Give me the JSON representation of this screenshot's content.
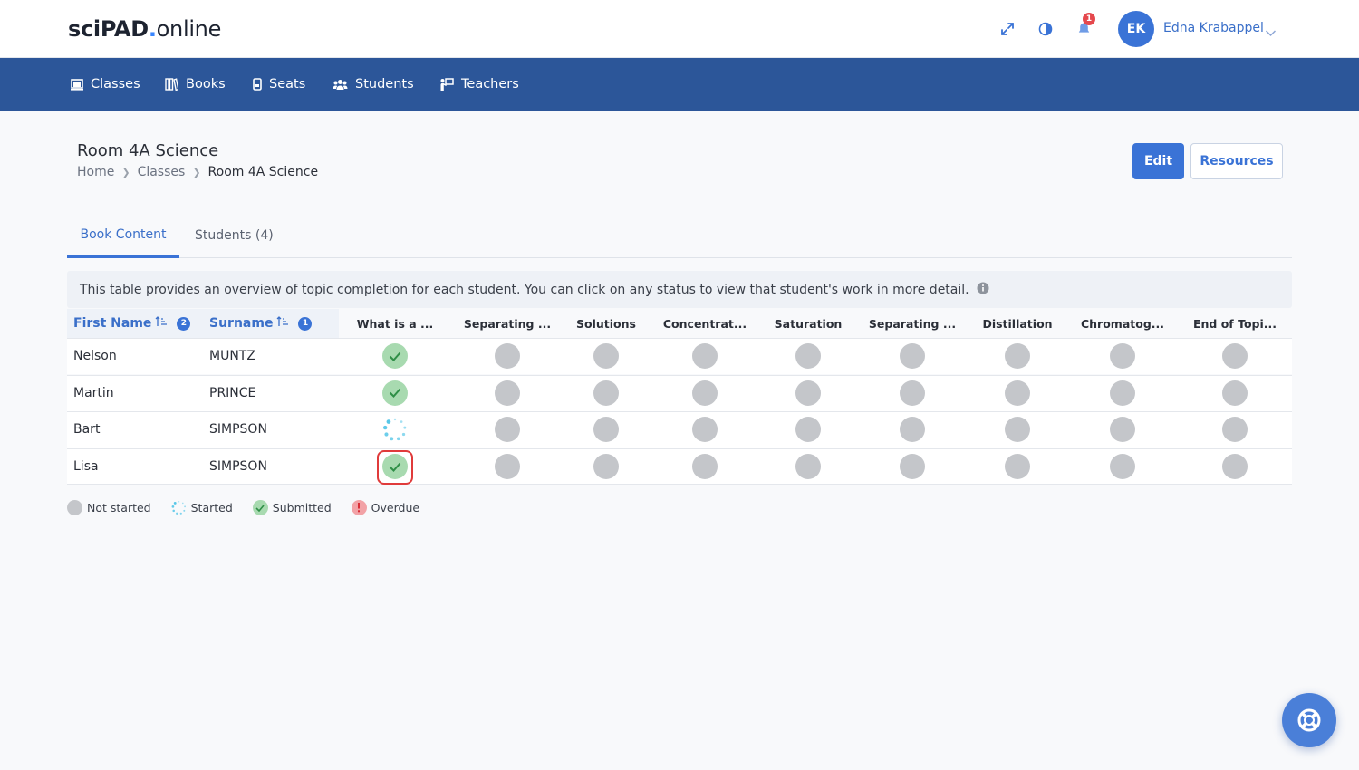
{
  "brand": {
    "part1": "sciPAD",
    "dot": ".",
    "part2": "online"
  },
  "user": {
    "initials": "EK",
    "name": "Edna Krabappel",
    "notifications": "1"
  },
  "nav": [
    {
      "label": "Classes",
      "icon": "classroom-icon"
    },
    {
      "label": "Books",
      "icon": "books-icon"
    },
    {
      "label": "Seats",
      "icon": "seat-icon"
    },
    {
      "label": "Students",
      "icon": "students-icon"
    },
    {
      "label": "Teachers",
      "icon": "teacher-icon"
    }
  ],
  "page": {
    "title": "Room 4A Science",
    "breadcrumb": [
      "Home",
      "Classes",
      "Room 4A Science"
    ],
    "edit_label": "Edit",
    "resources_label": "Resources"
  },
  "tabs": [
    {
      "label": "Book Content",
      "active": true
    },
    {
      "label": "Students (4)",
      "active": false
    }
  ],
  "info_text": "This table provides an overview of topic completion for each student. You can click on any status to view that student's work in more detail.",
  "table": {
    "sort_columns": [
      {
        "label": "First Name",
        "order": "2"
      },
      {
        "label": "Surname",
        "order": "1"
      }
    ],
    "topics": [
      "What is a ...",
      "Separating ...",
      "Solutions",
      "Concentrat...",
      "Saturation",
      "Separating ...",
      "Distillation",
      "Chromatog...",
      "End of Topi..."
    ],
    "rows": [
      {
        "first": "Nelson",
        "surname": "MUNTZ",
        "statuses": [
          "submitted",
          "not_started",
          "not_started",
          "not_started",
          "not_started",
          "not_started",
          "not_started",
          "not_started",
          "not_started"
        ]
      },
      {
        "first": "Martin",
        "surname": "PRINCE",
        "statuses": [
          "submitted",
          "not_started",
          "not_started",
          "not_started",
          "not_started",
          "not_started",
          "not_started",
          "not_started",
          "not_started"
        ]
      },
      {
        "first": "Bart",
        "surname": "SIMPSON",
        "statuses": [
          "started",
          "not_started",
          "not_started",
          "not_started",
          "not_started",
          "not_started",
          "not_started",
          "not_started",
          "not_started"
        ]
      },
      {
        "first": "Lisa",
        "surname": "SIMPSON",
        "statuses": [
          "submitted",
          "not_started",
          "not_started",
          "not_started",
          "not_started",
          "not_started",
          "not_started",
          "not_started",
          "not_started"
        ]
      }
    ]
  },
  "legend": [
    {
      "label": "Not started",
      "status": "not_started"
    },
    {
      "label": "Started",
      "status": "started"
    },
    {
      "label": "Submitted",
      "status": "submitted"
    },
    {
      "label": "Overdue",
      "status": "overdue"
    }
  ],
  "colors": {
    "nav_bg": "#2c5699",
    "accent": "#3a73d6",
    "not_started": "#c4c6ca",
    "submitted": "#a8dab0",
    "started": "#4cc3e6",
    "overdue": "#f2a2a6"
  }
}
